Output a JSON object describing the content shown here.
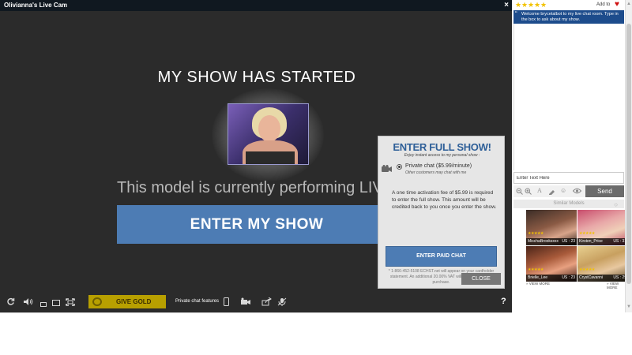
{
  "window": {
    "title": "Olivianna's Live Cam",
    "close_glyph": "×"
  },
  "stage": {
    "headline": "MY SHOW HAS STARTED",
    "performing_text": "This model is currently performing LIVE",
    "enter_button": "ENTER MY SHOW"
  },
  "controls": {
    "give_gold": "GIVE GOLD",
    "private_features": "Private chat features",
    "help": "?"
  },
  "popup": {
    "title": "ENTER FULL SHOW!",
    "subtitle": "Enjoy instant access to my personal show :",
    "option_label": "Private chat ($5.99/minute)",
    "option_note": "Other customers may chat with me",
    "fee_text": "A one time activation fee of $5.99 is required to enter the full show. This amount will be credited back to you once you enter the show.",
    "paid_button": "ENTER PAID CHAT",
    "billing_note": "* 1-866-452-5108 ECHST.net will appear on your cardholder statement. An additional 20.00% VAT will be charged upon purchase.",
    "close_button": "CLOSE"
  },
  "chat": {
    "rating_stars": 5,
    "add_to": "Add to",
    "welcome": "Welcome brycetalbot to my live chat room.  Type in the box to ask about my show.",
    "input_value": "Enter Text Here",
    "send": "Send"
  },
  "similar": {
    "title": "Similar Models",
    "models": [
      {
        "name": "MischaBrooksxxx",
        "country": "US",
        "age": "23"
      },
      {
        "name": "Kirsten_Price",
        "country": "US",
        "age": "31"
      },
      {
        "name": "Brielle_Lee",
        "country": "US",
        "age": "23"
      },
      {
        "name": "CrystCavanni",
        "country": "US",
        "age": "29"
      }
    ],
    "view_more": "» VIEW MORE"
  },
  "colors": {
    "accent_blue": "#4d7cb4",
    "gold": "#b8a000",
    "welcome_bg": "#1d4c8c",
    "star": "#f2c200"
  }
}
